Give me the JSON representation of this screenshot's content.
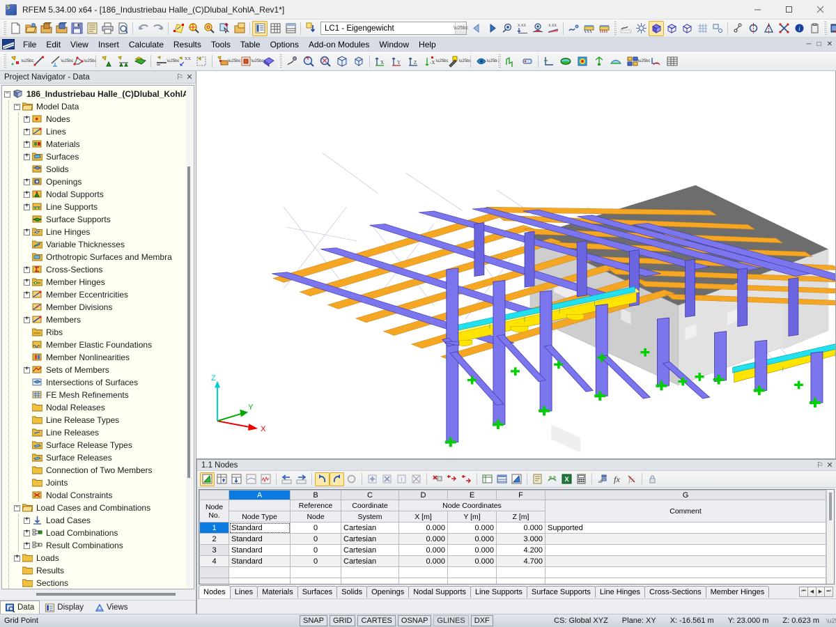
{
  "window": {
    "title": "RFEM 5.34.00 x64 - [186_Industriebau Halle_(C)Dlubal_KohlA_Rev1*]",
    "app_icon": "rfem-logo-icon",
    "minimize_label": "─",
    "maximize_label": "□",
    "close_label": "✕"
  },
  "menubar": {
    "logo": "dlubal-logo-icon",
    "items": [
      {
        "label": "File",
        "accel": "F"
      },
      {
        "label": "Edit",
        "accel": "E"
      },
      {
        "label": "View",
        "accel": "V"
      },
      {
        "label": "Insert",
        "accel": "I"
      },
      {
        "label": "Calculate",
        "accel": "C"
      },
      {
        "label": "Results",
        "accel": "R"
      },
      {
        "label": "Tools",
        "accel": "T"
      },
      {
        "label": "Table",
        "accel": "b"
      },
      {
        "label": "Options",
        "accel": "O"
      },
      {
        "label": "Add-on Modules",
        "accel": "A"
      },
      {
        "label": "Window",
        "accel": "W"
      },
      {
        "label": "Help",
        "accel": "H"
      }
    ],
    "mdi_buttons": [
      "─",
      "□",
      "✕"
    ]
  },
  "toolbar_main": {
    "load_case": {
      "value": "LC1 - Eigengewicht",
      "placeholder": "Select load case"
    },
    "icons": [
      "new-file-icon",
      "open-file-icon",
      "open-project-icon",
      "open-model-icon",
      "save-icon",
      "save-all-icon",
      "print-icon",
      "print-preview-icon",
      "undo-icon",
      "redo-icon",
      "select-special-icon",
      "zoom-select-icon",
      "zoom-details-icon",
      "pick-object-icon",
      "copy-layer-icon",
      "table-view-icon",
      "table-grid-icon",
      "table-full-icon",
      "load-case-new-icon",
      "prev-loadcase-icon",
      "next-loadcase-icon",
      "show-results-icon",
      "deformation-icon",
      "result-values-icon",
      "result-diagram-icon",
      "render-icon",
      "support-reactions-icon",
      "support-forces-icon",
      "shading-icon",
      "fe-mesh-icon",
      "solid-model-icon",
      "wireframe-icon",
      "transparent-icon",
      "grid-display-icon",
      "snap-object-icon",
      "node-link-icon",
      "mirror-axis-icon",
      "mirror-plane-icon",
      "delete-cross-icon",
      "info-icon",
      "clipboard-icon",
      "dlubal-center-icon"
    ]
  },
  "toolbar_insert": {
    "icons": [
      "new-node-icon",
      "new-line-icon",
      "new-dimension-icon",
      "new-polyline-icon",
      "new-nodal-support-icon",
      "new-line-support-icon",
      "new-surface-support-icon",
      "new-member-icon",
      "new-member-xx-icon",
      "new-surface-icon",
      "new-load-icon",
      "new-member-load-icon",
      "new-surface-load-icon",
      "select-objects-icon",
      "zoom-window-icon",
      "zoom-out-icon",
      "view-3d-icon",
      "view-iso-icon",
      "view-x-icon",
      "view-y-icon",
      "view-z-icon",
      "view-negx-icon",
      "edit-view-icon",
      "render-mode-icon",
      "member-result-icon",
      "result-table-icon",
      "axis-icon",
      "color-scale-icon",
      "contour-icon",
      "deform-display-icon",
      "section-icon",
      "panel-icon",
      "scale-icon",
      "grid-table-icon"
    ]
  },
  "navigator": {
    "title": "Project Navigator - Data",
    "pin_label": "⚐",
    "close_label": "✕",
    "tree": [
      {
        "level": 0,
        "label": "186_Industriebau Halle_(C)Dlubal_KohlA",
        "expander": "minus",
        "icon": "model-file-icon",
        "root": true
      },
      {
        "level": 1,
        "label": "Model Data",
        "expander": "minus",
        "icon": "folder-open-icon"
      },
      {
        "level": 2,
        "label": "Nodes",
        "expander": "plus",
        "icon": "nodes-icon"
      },
      {
        "level": 2,
        "label": "Lines",
        "expander": "plus",
        "icon": "lines-icon"
      },
      {
        "level": 2,
        "label": "Materials",
        "expander": "plus",
        "icon": "materials-icon"
      },
      {
        "level": 2,
        "label": "Surfaces",
        "expander": "plus",
        "icon": "surfaces-icon"
      },
      {
        "level": 2,
        "label": "Solids",
        "expander": "none",
        "icon": "solids-icon"
      },
      {
        "level": 2,
        "label": "Openings",
        "expander": "plus",
        "icon": "openings-icon"
      },
      {
        "level": 2,
        "label": "Nodal Supports",
        "expander": "plus",
        "icon": "nodal-supports-icon"
      },
      {
        "level": 2,
        "label": "Line Supports",
        "expander": "plus",
        "icon": "line-supports-icon"
      },
      {
        "level": 2,
        "label": "Surface Supports",
        "expander": "none",
        "icon": "surface-supports-icon"
      },
      {
        "level": 2,
        "label": "Line Hinges",
        "expander": "plus",
        "icon": "line-hinges-icon"
      },
      {
        "level": 2,
        "label": "Variable Thicknesses",
        "expander": "none",
        "icon": "variable-thicknesses-icon"
      },
      {
        "level": 2,
        "label": "Orthotropic Surfaces and Membra",
        "expander": "none",
        "icon": "orthotropic-icon"
      },
      {
        "level": 2,
        "label": "Cross-Sections",
        "expander": "plus",
        "icon": "cross-sections-icon"
      },
      {
        "level": 2,
        "label": "Member Hinges",
        "expander": "plus",
        "icon": "member-hinges-icon"
      },
      {
        "level": 2,
        "label": "Member Eccentricities",
        "expander": "plus",
        "icon": "member-eccentricities-icon"
      },
      {
        "level": 2,
        "label": "Member Divisions",
        "expander": "none",
        "icon": "member-divisions-icon"
      },
      {
        "level": 2,
        "label": "Members",
        "expander": "plus",
        "icon": "members-icon"
      },
      {
        "level": 2,
        "label": "Ribs",
        "expander": "none",
        "icon": "ribs-icon"
      },
      {
        "level": 2,
        "label": "Member Elastic Foundations",
        "expander": "none",
        "icon": "member-elastic-foundations-icon"
      },
      {
        "level": 2,
        "label": "Member Nonlinearities",
        "expander": "none",
        "icon": "member-nonlinearities-icon"
      },
      {
        "level": 2,
        "label": "Sets of Members",
        "expander": "plus",
        "icon": "sets-of-members-icon"
      },
      {
        "level": 2,
        "label": "Intersections of Surfaces",
        "expander": "none",
        "icon": "intersections-icon"
      },
      {
        "level": 2,
        "label": "FE Mesh Refinements",
        "expander": "none",
        "icon": "fe-mesh-refinements-icon"
      },
      {
        "level": 2,
        "label": "Nodal Releases",
        "expander": "none",
        "icon": "nodal-releases-icon"
      },
      {
        "level": 2,
        "label": "Line Release Types",
        "expander": "none",
        "icon": "line-release-types-icon"
      },
      {
        "level": 2,
        "label": "Line Releases",
        "expander": "none",
        "icon": "line-releases-icon"
      },
      {
        "level": 2,
        "label": "Surface Release Types",
        "expander": "none",
        "icon": "surface-release-types-icon"
      },
      {
        "level": 2,
        "label": "Surface Releases",
        "expander": "none",
        "icon": "surface-releases-icon"
      },
      {
        "level": 2,
        "label": "Connection of Two Members",
        "expander": "none",
        "icon": "connection-two-members-icon"
      },
      {
        "level": 2,
        "label": "Joints",
        "expander": "none",
        "icon": "joints-icon"
      },
      {
        "level": 2,
        "label": "Nodal Constraints",
        "expander": "none",
        "icon": "nodal-constraints-icon"
      },
      {
        "level": 1,
        "label": "Load Cases and Combinations",
        "expander": "minus",
        "icon": "folder-open-icon"
      },
      {
        "level": 2,
        "label": "Load Cases",
        "expander": "plus",
        "icon": "load-cases-icon"
      },
      {
        "level": 2,
        "label": "Load Combinations",
        "expander": "plus",
        "icon": "load-combinations-icon"
      },
      {
        "level": 2,
        "label": "Result Combinations",
        "expander": "plus",
        "icon": "result-combinations-icon"
      },
      {
        "level": 1,
        "label": "Loads",
        "expander": "plus",
        "icon": "folder-closed-icon"
      },
      {
        "level": 1,
        "label": "Results",
        "expander": "none",
        "icon": "folder-closed-icon"
      },
      {
        "level": 1,
        "label": "Sections",
        "expander": "none",
        "icon": "folder-closed-icon"
      }
    ],
    "tabs": [
      {
        "label": "Data",
        "icon": "data-tab-icon",
        "selected": true
      },
      {
        "label": "Display",
        "icon": "display-tab-icon",
        "selected": false
      },
      {
        "label": "Views",
        "icon": "views-tab-icon",
        "selected": false
      }
    ]
  },
  "viewport": {
    "axis_labels": {
      "x": "X",
      "y": "Y",
      "z": "Z"
    },
    "colors": {
      "member_steel": "#7b76ee",
      "purlin": "#f5a623",
      "crane_beam": "#ffe400",
      "crane_rail": "#22e0ee",
      "wall_panel": "#d4d4d4",
      "roof_panel": "#6b6b6b",
      "support": "#00d000",
      "axis_x": "#ee0000",
      "axis_y": "#00aa00",
      "axis_z": "#00cccc",
      "background": "#ffffff"
    }
  },
  "table_panel": {
    "title": "1.1 Nodes",
    "pin_label": "⚐",
    "close_label": "✕",
    "toolbar_icons": [
      "edit-table-icon",
      "insert-row-icon",
      "insert-column-icon",
      "table-export-icon",
      "table-chart-icon",
      "prev-table-icon",
      "next-table-icon",
      "undo-table-icon",
      "redo-table-icon",
      "refresh-table-icon",
      "add-row-icon",
      "remove-row-icon",
      "info-row-icon",
      "clear-table-icon",
      "delete-row-icon",
      "insert-above-icon",
      "insert-below-icon",
      "table-format-icon",
      "table-color-icon",
      "table-edit-icon",
      "print-table-icon",
      "print-all-icon",
      "export-excel-icon",
      "calculator-icon",
      "sort-icon",
      "function-icon",
      "no-function-icon",
      "lock-icon"
    ],
    "column_letters": [
      "",
      "A",
      "B",
      "C",
      "D",
      "E",
      "F",
      "G"
    ],
    "selected_column": "A",
    "headers": {
      "row_label": [
        "Node",
        "No."
      ],
      "groups": [
        {
          "label": "Node Type",
          "span": 1
        },
        {
          "label": "Reference",
          "sub": "Node",
          "span": 1
        },
        {
          "label": "Coordinate",
          "sub": "System",
          "span": 1
        },
        {
          "label": "Node Coordinates",
          "span": 3,
          "subs": [
            "X [m]",
            "Y [m]",
            "Z [m]"
          ]
        },
        {
          "label": "Comment",
          "span": 1
        }
      ]
    },
    "rows": [
      {
        "no": "1",
        "node_type": "Standard",
        "ref_node": "0",
        "coord_system": "Cartesian",
        "x": "0.000",
        "y": "0.000",
        "z": "0.000",
        "comment": "Supported",
        "selected": true
      },
      {
        "no": "2",
        "node_type": "Standard",
        "ref_node": "0",
        "coord_system": "Cartesian",
        "x": "0.000",
        "y": "0.000",
        "z": "3.000",
        "comment": "",
        "selected": false
      },
      {
        "no": "3",
        "node_type": "Standard",
        "ref_node": "0",
        "coord_system": "Cartesian",
        "x": "0.000",
        "y": "0.000",
        "z": "4.200",
        "comment": "",
        "selected": false
      },
      {
        "no": "4",
        "node_type": "Standard",
        "ref_node": "0",
        "coord_system": "Cartesian",
        "x": "0.000",
        "y": "0.000",
        "z": "4.700",
        "comment": "",
        "selected": false
      }
    ],
    "tabs": [
      {
        "label": "Nodes",
        "selected": true
      },
      {
        "label": "Lines",
        "selected": false
      },
      {
        "label": "Materials",
        "selected": false
      },
      {
        "label": "Surfaces",
        "selected": false
      },
      {
        "label": "Solids",
        "selected": false
      },
      {
        "label": "Openings",
        "selected": false
      },
      {
        "label": "Nodal Supports",
        "selected": false
      },
      {
        "label": "Line Supports",
        "selected": false
      },
      {
        "label": "Surface Supports",
        "selected": false
      },
      {
        "label": "Line Hinges",
        "selected": false
      },
      {
        "label": "Cross-Sections",
        "selected": false
      },
      {
        "label": "Member Hinges",
        "selected": false
      }
    ],
    "nav_buttons": [
      "⏮",
      "◀",
      "▶",
      "⏭"
    ]
  },
  "statusbar": {
    "message": "Grid Point",
    "toggles": [
      {
        "label": "SNAP",
        "active": true
      },
      {
        "label": "GRID",
        "active": true
      },
      {
        "label": "CARTES",
        "active": true
      },
      {
        "label": "OSNAP",
        "active": true
      },
      {
        "label": "GLINES",
        "active": false
      },
      {
        "label": "DXF",
        "active": true
      }
    ],
    "cs": "CS: Global XYZ",
    "plane": "Plane: XY",
    "coord_x": "X:  -16.561 m",
    "coord_y": "Y:  23.000 m",
    "coord_z": "Z:  0.623 m"
  }
}
